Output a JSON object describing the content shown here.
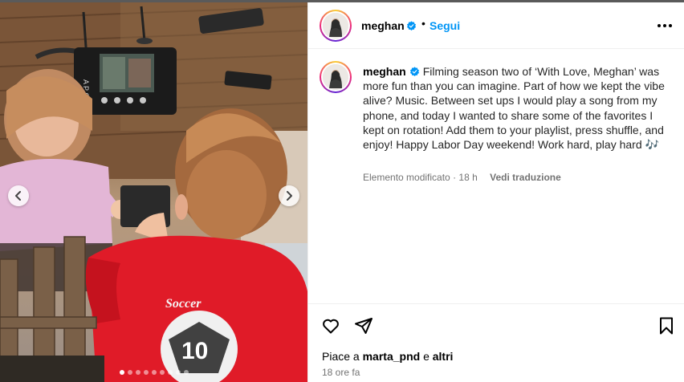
{
  "post": {
    "author": {
      "username": "meghan",
      "verified": true,
      "follow_label": "Segui",
      "separator": "•"
    },
    "caption": "Filming season two of ‘With Love, Meghan’ was more fun than you can imagine. Part of how we kept the vibe alive? Music. Between set ups I would play a song from my phone, and today I wanted to share some of the favorites I kept on rotation! Add them to your playlist, press shuffle, and enjoy! Happy Labor Day weekend! Work hard, play hard 🎶",
    "meta": {
      "edited_label": "Elemento modificato",
      "dot": "·",
      "age": "18 h",
      "translate_label": "Vedi traduzione"
    },
    "likes": {
      "prefix": "Piace a",
      "user": "marta_pnd",
      "conjunction": "e",
      "others": "altri"
    },
    "timestamp": "18 ore fa"
  },
  "carousel": {
    "total_slides": 9,
    "active_index": 0
  },
  "photo": {
    "monitor_letters": "A P C",
    "shirt_text": "Soccer",
    "shirt_number": "10"
  },
  "icons": {
    "verified": "verified-badge-icon",
    "more": "more-options-icon",
    "prev": "chevron-left-icon",
    "next": "chevron-right-icon",
    "like": "heart-icon",
    "share": "paper-plane-icon",
    "save": "bookmark-icon"
  },
  "colors": {
    "accent": "#0095f6",
    "verified": "#0095f6",
    "secondary_text": "#737373",
    "divider": "#efefef"
  }
}
